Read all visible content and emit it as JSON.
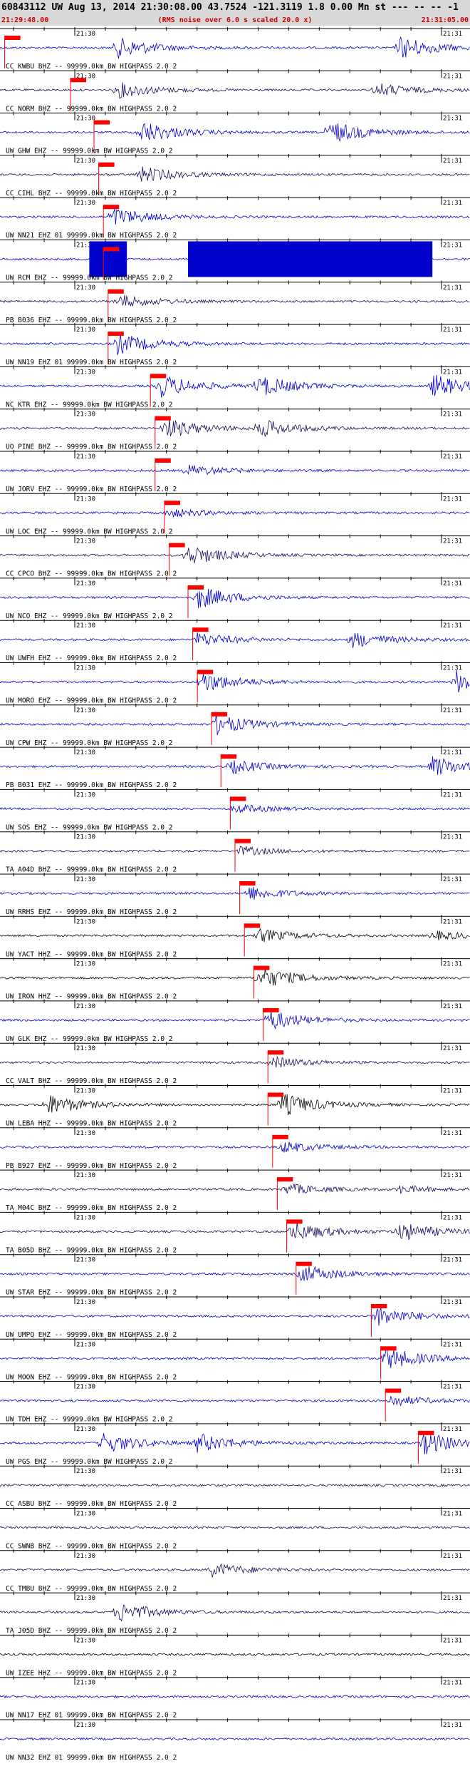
{
  "header": {
    "title": "60843112 UW Aug 13, 2014 21:30:08.00   43.7524 -121.3119  1.8 0.00 Mn st --- -- --  -1",
    "subtitle": "(RMS noise over 6.0 s scaled 20.0 x)",
    "start_time": "21:29:48.00",
    "end_time": "21:31:05.00"
  },
  "colors": {
    "blue": "#0000cc",
    "navy": "#1a0a5a",
    "black": "#000000",
    "pick": "#ff0000",
    "title": "#000000",
    "subtitle": "#cc0000"
  },
  "chart_data": {
    "type": "line",
    "title": "60843112 UW Aug 13, 2014 21:30:08.00   43.7524 -121.3119  1.8 0.00 Mn st --- -- --  -1",
    "subtitle": "(RMS noise over 6.0 s scaled 20.0 x)",
    "x_range": [
      "21:29:48.00",
      "21:31:05.00"
    ],
    "tick_labels": [
      "21:30",
      "21:31"
    ],
    "traces": [
      {
        "label": "CC KWBU BHZ -- 99999.0km BW  HIGHPASS  2.0  2",
        "color": "blue",
        "pick": 0.01,
        "events": [
          [
            0.25,
            0.9
          ],
          [
            0.85,
            1.0
          ]
        ]
      },
      {
        "label": "CC NORM BHZ -- 99999.0km BW  HIGHPASS  2.0  2",
        "color": "navy",
        "pick": 0.15,
        "events": [
          [
            0.25,
            0.7
          ],
          [
            0.8,
            0.6
          ]
        ]
      },
      {
        "label": "UW GHW EHZ -- 99999.0km BW  HIGHPASS  2.0  2",
        "color": "blue",
        "pick": 0.2,
        "events": [
          [
            0.3,
            1.0
          ],
          [
            0.7,
            1.0
          ]
        ]
      },
      {
        "label": "CC CIHL BHZ -- 99999.0km BW  HIGHPASS  2.0  2",
        "color": "navy",
        "pick": 0.21,
        "events": [
          [
            0.3,
            0.7
          ]
        ]
      },
      {
        "label": "UW NN21 EHZ 01 99999.0km BW  HIGHPASS  2.0  2",
        "color": "blue",
        "pick": 0.22,
        "events": [
          [
            0.24,
            0.8
          ]
        ]
      },
      {
        "label": "UW RCM EHZ -- 99999.0km BW  HIGHPASS  2.0  2",
        "color": "blue",
        "pick": 0.22,
        "events": [],
        "saturated": [
          [
            0.19,
            0.27
          ],
          [
            0.4,
            0.92
          ]
        ]
      },
      {
        "label": "PB B036 EHZ -- 99999.0km BW  HIGHPASS  2.0  2",
        "color": "navy",
        "pick": 0.23,
        "events": [
          [
            0.25,
            0.6
          ]
        ]
      },
      {
        "label": "UW NN19 EHZ 01 99999.0km BW  HIGHPASS  2.0  2",
        "color": "blue",
        "pick": 0.23,
        "events": [
          [
            0.25,
            0.9
          ]
        ]
      },
      {
        "label": "NC KTR EHZ -- 99999.0km BW  HIGHPASS  2.0  2",
        "color": "blue",
        "pick": 0.32,
        "events": [
          [
            0.34,
            1.0
          ],
          [
            0.55,
            0.9
          ],
          [
            0.92,
            1.0
          ]
        ]
      },
      {
        "label": "UO PINE BHZ -- 99999.0km BW  HIGHPASS  2.0  2",
        "color": "navy",
        "pick": 0.33,
        "events": [
          [
            0.35,
            0.9
          ],
          [
            0.55,
            0.8
          ]
        ]
      },
      {
        "label": "UW JORV EHZ -- 99999.0km BW  HIGHPASS  2.0  2",
        "color": "blue",
        "pick": 0.33,
        "events": [
          [
            0.4,
            0.5
          ]
        ]
      },
      {
        "label": "UW LOC EHZ -- 99999.0km BW  HIGHPASS  2.0  2",
        "color": "blue",
        "pick": 0.35,
        "events": [
          [
            0.36,
            0.4
          ]
        ]
      },
      {
        "label": "CC CPCO BHZ -- 99999.0km BW  HIGHPASS  2.0  2",
        "color": "navy",
        "pick": 0.36,
        "events": [
          [
            0.4,
            0.9
          ]
        ]
      },
      {
        "label": "UW NCO EHZ -- 99999.0km BW  HIGHPASS  2.0  2",
        "color": "blue",
        "pick": 0.4,
        "events": [
          [
            0.42,
            1.0
          ]
        ]
      },
      {
        "label": "UW UWFH EHZ -- 99999.0km BW  HIGHPASS  2.0  2",
        "color": "blue",
        "pick": 0.41,
        "events": [
          [
            0.42,
            0.6
          ],
          [
            0.75,
            0.7
          ]
        ]
      },
      {
        "label": "UW MORO EHZ -- 99999.0km BW  HIGHPASS  2.0  2",
        "color": "blue",
        "pick": 0.42,
        "events": [
          [
            0.43,
            0.9
          ],
          [
            0.97,
            1.0
          ]
        ]
      },
      {
        "label": "UW CPW EHZ -- 99999.0km BW  HIGHPASS  2.0  2",
        "color": "blue",
        "pick": 0.45,
        "events": [
          [
            0.46,
            0.9
          ]
        ]
      },
      {
        "label": "PB B031 EHZ -- 99999.0km BW  HIGHPASS  2.0  2",
        "color": "blue",
        "pick": 0.47,
        "events": [
          [
            0.49,
            0.6
          ],
          [
            0.92,
            0.9
          ]
        ]
      },
      {
        "label": "UW SOS EHZ -- 99999.0km BW  HIGHPASS  2.0  2",
        "color": "blue",
        "pick": 0.49,
        "events": [
          [
            0.5,
            0.4
          ]
        ]
      },
      {
        "label": "TA A04D BHZ -- 99999.0km BW  HIGHPASS  2.0  2",
        "color": "navy",
        "pick": 0.5,
        "events": [
          [
            0.51,
            0.4
          ]
        ]
      },
      {
        "label": "UW RRHS EHZ -- 99999.0km BW  HIGHPASS  2.0  2",
        "color": "blue",
        "pick": 0.51,
        "events": [
          [
            0.53,
            0.6
          ]
        ]
      },
      {
        "label": "UW YACT HHZ -- 99999.0km BW  HIGHPASS  2.0  2",
        "color": "black",
        "pick": 0.52,
        "events": [
          [
            0.55,
            0.6
          ],
          [
            0.92,
            0.4
          ]
        ]
      },
      {
        "label": "UW IRON HHZ -- 99999.0km BW  HIGHPASS  2.0  2",
        "color": "black",
        "pick": 0.54,
        "events": [
          [
            0.55,
            1.0
          ]
        ]
      },
      {
        "label": "UW GLK EHZ -- 99999.0km BW  HIGHPASS  2.0  2",
        "color": "blue",
        "pick": 0.56,
        "events": [
          [
            0.57,
            0.9
          ]
        ]
      },
      {
        "label": "CC VALT BHZ -- 99999.0km BW  HIGHPASS  2.0  2",
        "color": "navy",
        "pick": 0.57,
        "events": [
          [
            0.58,
            0.5
          ]
        ]
      },
      {
        "label": "UW LEBA HHZ -- 99999.0km BW  HIGHPASS  2.0  2",
        "color": "black",
        "pick": 0.57,
        "events": [
          [
            0.1,
            0.9
          ],
          [
            0.6,
            1.0
          ]
        ]
      },
      {
        "label": "PB B927 EHZ -- 99999.0km BW  HIGHPASS  2.0  2",
        "color": "blue",
        "pick": 0.58,
        "events": [
          [
            0.6,
            0.5
          ]
        ]
      },
      {
        "label": "TA M04C BHZ -- 99999.0km BW  HIGHPASS  2.0  2",
        "color": "navy",
        "pick": 0.59,
        "events": [
          [
            0.61,
            0.5
          ],
          [
            0.85,
            0.3
          ]
        ]
      },
      {
        "label": "TA B05D BHZ -- 99999.0km BW  HIGHPASS  2.0  2",
        "color": "navy",
        "pick": 0.61,
        "events": [
          [
            0.62,
            0.9
          ],
          [
            0.85,
            0.8
          ]
        ]
      },
      {
        "label": "UW STAR EHZ -- 99999.0km BW  HIGHPASS  2.0  2",
        "color": "blue",
        "pick": 0.63,
        "events": [
          [
            0.64,
            0.8
          ]
        ]
      },
      {
        "label": "UW UMPQ EHZ -- 99999.0km BW  HIGHPASS  2.0  2",
        "color": "blue",
        "pick": 0.79,
        "events": [
          [
            0.8,
            0.9
          ]
        ]
      },
      {
        "label": "UW MOON EHZ -- 99999.0km BW  HIGHPASS  2.0  2",
        "color": "blue",
        "pick": 0.81,
        "events": [
          [
            0.82,
            1.0
          ]
        ]
      },
      {
        "label": "UW TDH EHZ -- 99999.0km BW  HIGHPASS  2.0  2",
        "color": "blue",
        "pick": 0.82,
        "events": [
          [
            0.83,
            0.5
          ]
        ]
      },
      {
        "label": "UW PGS EHZ -- 99999.0km BW  HIGHPASS  2.0  2",
        "color": "blue",
        "pick": 0.89,
        "events": [
          [
            0.22,
            0.9
          ],
          [
            0.42,
            0.8
          ],
          [
            0.9,
            1.0
          ]
        ]
      },
      {
        "label": "CC ASBU BHZ -- 99999.0km BW  HIGHPASS  2.0  2",
        "color": "navy",
        "pick": null,
        "events": []
      },
      {
        "label": "CC SWNB BHZ -- 99999.0km BW  HIGHPASS  2.0  2",
        "color": "navy",
        "pick": null,
        "events": []
      },
      {
        "label": "CC TMBU BHZ -- 99999.0km BW  HIGHPASS  2.0  2",
        "color": "navy",
        "pick": null,
        "events": [
          [
            0.45,
            0.6
          ]
        ]
      },
      {
        "label": "TA J05D BHZ -- 99999.0km BW  HIGHPASS  2.0  2",
        "color": "navy",
        "pick": null,
        "events": [
          [
            0.25,
            0.9
          ]
        ]
      },
      {
        "label": "UW IZEE HHZ -- 99999.0km BW  HIGHPASS  2.0  2",
        "color": "black",
        "pick": null,
        "events": []
      },
      {
        "label": "UW NN17 EHZ 01 99999.0km BW  HIGHPASS  2.0  2",
        "color": "blue",
        "pick": null,
        "events": []
      },
      {
        "label": "UW NN32 EHZ 01 99999.0km BW  HIGHPASS  2.0  2",
        "color": "blue",
        "pick": null,
        "events": []
      }
    ]
  }
}
